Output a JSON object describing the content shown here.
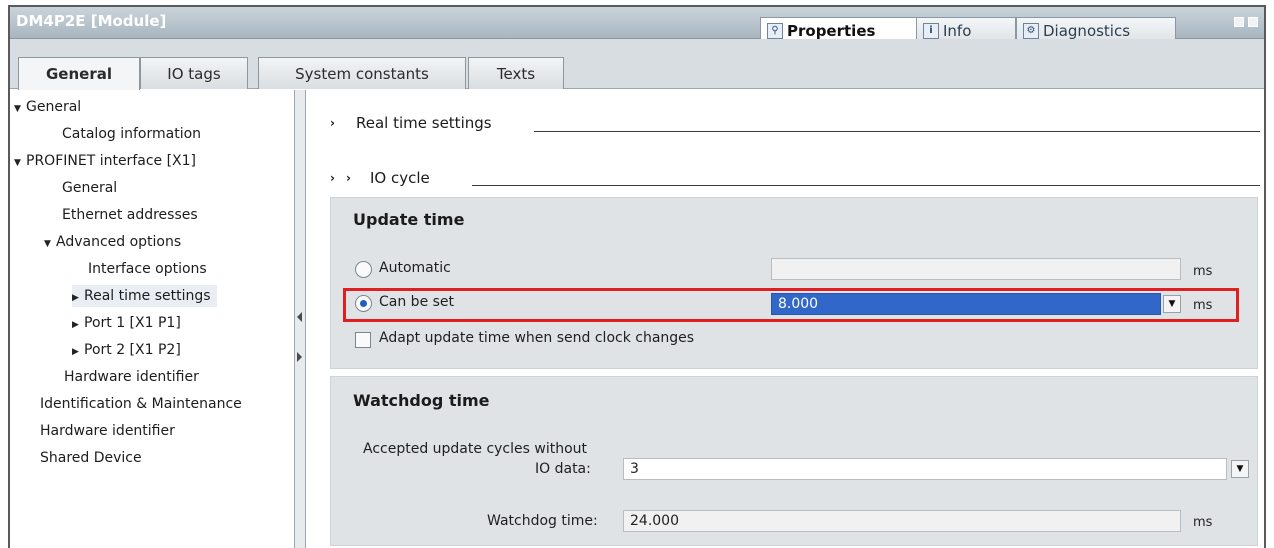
{
  "window": {
    "title": "DM4P2E [Module]",
    "inspector_tabs": [
      "Properties",
      "Info",
      "Diagnostics"
    ]
  },
  "tabs": [
    "General",
    "IO tags",
    "System constants",
    "Texts"
  ],
  "tree": {
    "general": "General",
    "catalog": "Catalog information",
    "profinet": "PROFINET interface [X1]",
    "pn_general": "General",
    "ethernet": "Ethernet addresses",
    "advanced": "Advanced options",
    "interface_opts": "Interface options",
    "realtime": "Real time settings",
    "port1": "Port 1 [X1 P1]",
    "port2": "Port 2 [X1 P2]",
    "hw_id_inner": "Hardware identifier",
    "ident_maint": "Identification & Maintenance",
    "hw_id": "Hardware identifier",
    "shared": "Shared Device"
  },
  "content": {
    "section_realtime": "Real time settings",
    "section_iocycle": "IO cycle",
    "update_time": {
      "title": "Update time",
      "automatic_label": "Automatic",
      "automatic_value": "",
      "can_be_set_label": "Can be set",
      "can_be_set_value": "8.000",
      "unit": "ms",
      "adapt_label": "Adapt update time when send clock changes"
    },
    "watchdog": {
      "title": "Watchdog time",
      "accepted_label_1": "Accepted update cycles without",
      "accepted_label_2": "IO data:",
      "accepted_value": "3",
      "watchdog_label": "Watchdog time:",
      "watchdog_value": "24.000",
      "unit": "ms"
    }
  },
  "icons": {
    "properties": "properties-icon",
    "info": "info-icon",
    "diagnostics": "diagnostics-icon"
  },
  "colors": {
    "highlight_box": "#e02020",
    "selected_field": "#3167c9"
  }
}
